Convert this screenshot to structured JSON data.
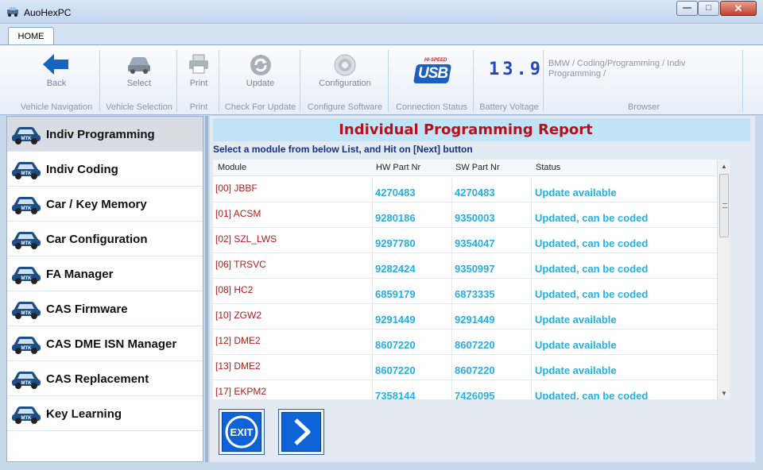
{
  "window": {
    "title": "AuoHexPC",
    "min_icon": "minimize-icon",
    "max_icon": "maximize-icon",
    "close_icon": "close-icon"
  },
  "ribbon": {
    "tab": "HOME",
    "groups": [
      {
        "label": "Back",
        "caption": "Vehicle Navigation",
        "icon": "back-arrow-icon"
      },
      {
        "label": "Select",
        "caption": "Vehicle Selection",
        "icon": "car-icon"
      },
      {
        "label": "Print",
        "caption": "Print",
        "icon": "printer-icon"
      },
      {
        "label": "Update",
        "caption": "Check For Update",
        "icon": "refresh-icon"
      },
      {
        "label": "Configuration",
        "caption": "Configure Software",
        "icon": "gear-icon"
      },
      {
        "label": "USB",
        "badge": "HI-SPEED",
        "caption": "Connection Status",
        "icon": "usb-icon"
      },
      {
        "label": "13.9",
        "caption": "Battery Voltage",
        "icon": "lcd-display-icon"
      },
      {
        "label": "",
        "caption": "Browser"
      }
    ],
    "browser_path": "BMW / Coding/Programming / Indiv Programming /"
  },
  "sidebar": {
    "items": [
      {
        "label": "Indiv Programming",
        "active": true
      },
      {
        "label": "Indiv Coding"
      },
      {
        "label": "Car / Key Memory"
      },
      {
        "label": "Car Configuration"
      },
      {
        "label": "FA Manager"
      },
      {
        "label": "CAS Firmware"
      },
      {
        "label": "CAS DME ISN Manager"
      },
      {
        "label": "CAS Replacement"
      },
      {
        "label": "Key Learning"
      }
    ],
    "item_icon_text": "MTK"
  },
  "report": {
    "title": "Individual Programming Report",
    "instruction": "Select a module from below List, and Hit on [Next] button",
    "columns": [
      "Module",
      "HW Part Nr",
      "SW Part Nr",
      "Status"
    ],
    "rows": [
      {
        "module": "[00] JBBF",
        "hw": "4270483",
        "sw": "4270483",
        "status": "Update available"
      },
      {
        "module": "[01] ACSM",
        "hw": "9280186",
        "sw": "9350003",
        "status": "Updated, can be coded"
      },
      {
        "module": "[02] SZL_LWS",
        "hw": "9297780",
        "sw": "9354047",
        "status": "Updated, can be coded"
      },
      {
        "module": "[06] TRSVC",
        "hw": "9282424",
        "sw": "9350997",
        "status": "Updated, can be coded"
      },
      {
        "module": "[08] HC2",
        "hw": "6859179",
        "sw": "6873335",
        "status": "Updated, can be coded"
      },
      {
        "module": "[10] ZGW2",
        "hw": "9291449",
        "sw": "9291449",
        "status": "Update available"
      },
      {
        "module": "[12] DME2",
        "hw": "8607220",
        "sw": "8607220",
        "status": "Update available"
      },
      {
        "module": "[13] DME2",
        "hw": "8607220",
        "sw": "8607220",
        "status": "Update available"
      },
      {
        "module": "[17] EKPM2",
        "hw": "7358144",
        "sw": "7426095",
        "status": "Updated, can be coded"
      }
    ]
  },
  "buttons": {
    "exit": "EXIT",
    "next_icon": "chevron-right-icon"
  },
  "colors": {
    "accent": "#0e63d8",
    "title_red": "#b5121b",
    "value_blue": "#27aee3"
  }
}
